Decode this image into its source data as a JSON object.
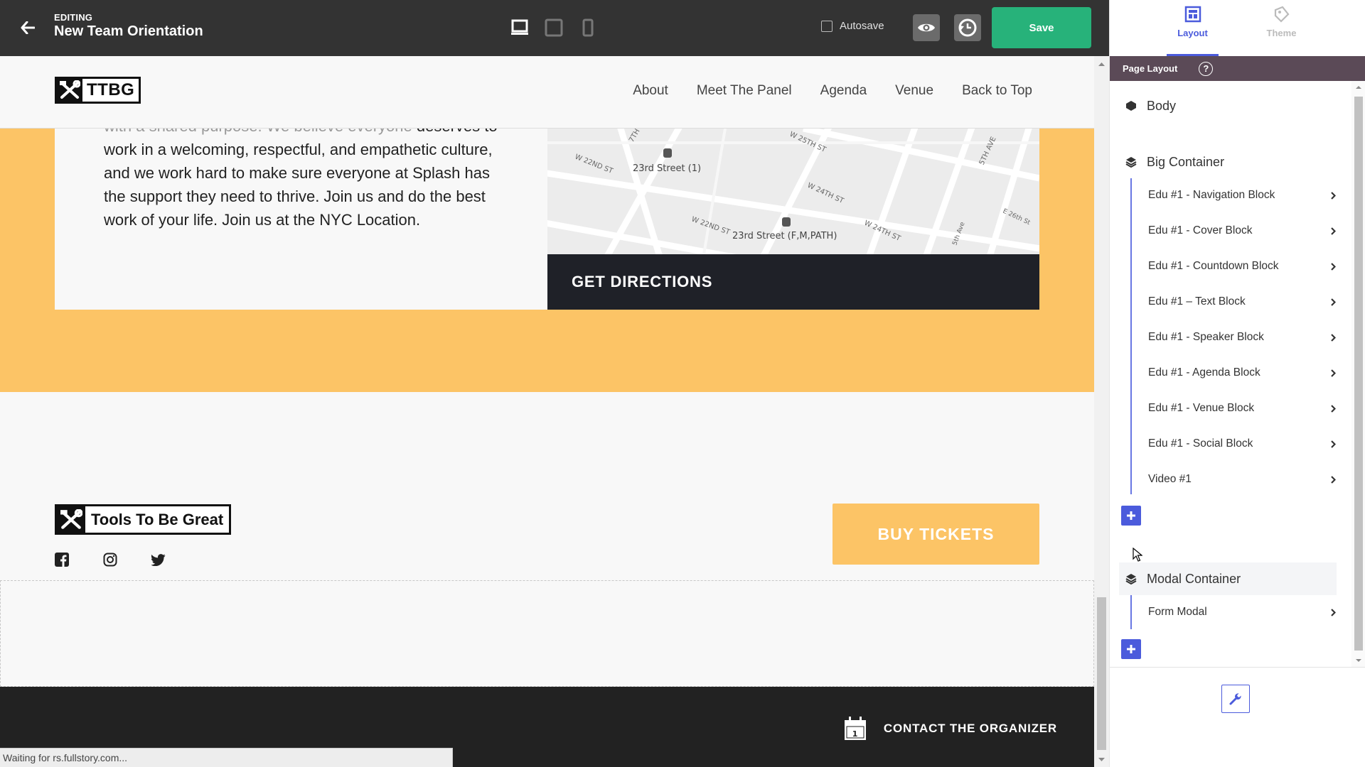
{
  "editor": {
    "editing_label": "EDITING",
    "page_title": "New Team Orientation",
    "autosave_label": "Autosave",
    "autosave_checked": false,
    "save_label": "Save",
    "save_color": "#27b27a"
  },
  "site": {
    "logo_text": "TTBG",
    "nav": [
      "About",
      "Meet The Panel",
      "Agenda",
      "Venue",
      "Back to Top"
    ],
    "venue_text_faded": "with a shared purpose. We believe everyone",
    "venue_text": "deserves to work in a welcoming, respectful, and empathetic culture, and we work hard to make sure everyone at Splash has the support they need to thrive. Join us and do the best work of your life. Join us at the NYC Location.",
    "map_labels": {
      "station1": "23rd Street (1)",
      "station2": "23rd Street (F,M,PATH)",
      "st_w22_a": "W 22ND ST",
      "st_w22_b": "W 22ND ST",
      "st_w25": "W 25TH ST",
      "st_w24_a": "W 24TH ST",
      "st_w24_b": "W 24TH ST",
      "st_5th": "5TH AVE",
      "st_e26": "E 26th St",
      "st_5th_b": "5th Ave",
      "st_7th": "7TH"
    },
    "directions_label": "GET DIRECTIONS",
    "footer_logo_text": "Tools To Be Great",
    "buy_tickets_label": "BUY TICKETS",
    "contact_label": "CONTACT THE ORGANIZER",
    "calendar_day": "1",
    "accent_color": "#fcc466"
  },
  "status_bar": "Waiting for rs.fullstory.com...",
  "panel": {
    "tabs": [
      {
        "label": "Layout",
        "active": true,
        "icon": "layout-icon"
      },
      {
        "label": "Theme",
        "active": false,
        "icon": "theme-icon"
      }
    ],
    "section_title": "Page Layout",
    "help": "?",
    "body_label": "Body",
    "big_container": {
      "label": "Big Container",
      "children": [
        "Edu #1 - Navigation Block",
        "Edu #1 - Cover Block",
        "Edu #1 - Countdown Block",
        "Edu #1 – Text Block",
        "Edu #1 - Speaker Block",
        "Edu #1 - Agenda Block",
        "Edu #1 - Venue Block",
        "Edu #1 - Social Block",
        "Video #1"
      ]
    },
    "modal_container": {
      "label": "Modal Container",
      "children": [
        "Form Modal"
      ]
    },
    "accent_color": "#4b5bdc"
  }
}
